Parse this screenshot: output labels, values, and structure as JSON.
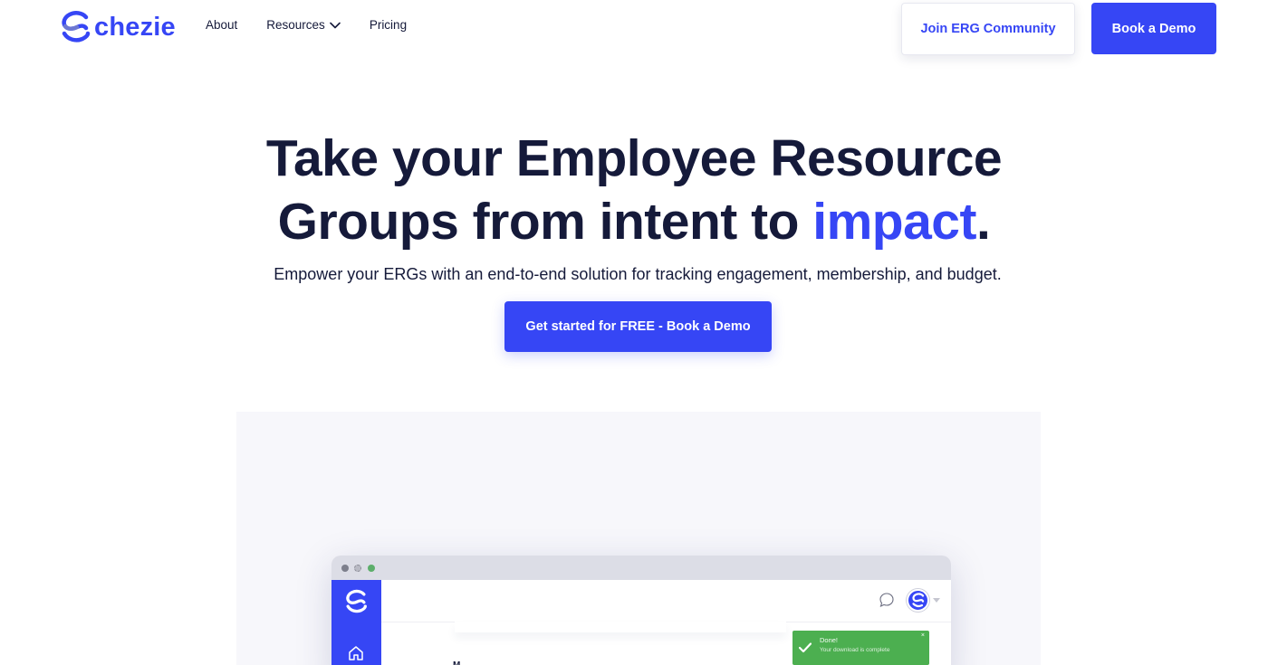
{
  "brand": {
    "name": "chezie",
    "color": "#3646f5"
  },
  "nav": {
    "links": [
      {
        "label": "About"
      },
      {
        "label": "Resources",
        "has_dropdown": true
      },
      {
        "label": "Pricing"
      }
    ],
    "join_label": "Join ERG Community",
    "demo_label": "Book a Demo"
  },
  "hero": {
    "title_part1": "Take your Employee Resource",
    "title_part2": "Groups from intent to ",
    "title_accent": "impact",
    "title_end": ".",
    "subtitle": "Empower your ERGs with an end-to-end solution for tracking engagement, membership, and budget.",
    "cta_label": "Get started for FREE - Book a Demo"
  },
  "app_preview": {
    "toast_title": "Done!",
    "toast_message": "Your download is complete",
    "toast_close": "×",
    "heading_fragment": "M"
  }
}
